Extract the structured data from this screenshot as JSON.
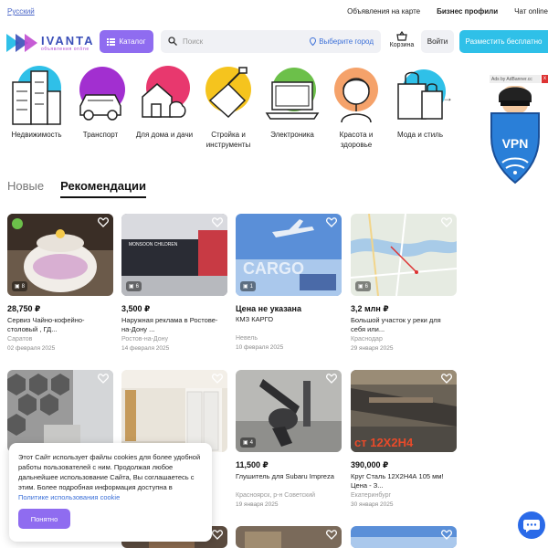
{
  "topbar": {
    "language": "Русский",
    "links": [
      "Объявления на карте",
      "Бизнес профили",
      "Чат online"
    ]
  },
  "header": {
    "logo_text": "IVANTA",
    "logo_sub": "объявления online",
    "catalog_label": "Каталог",
    "search_placeholder": "Поиск",
    "location_label": "Выберите город",
    "cart_label": "Корзина",
    "login_label": "Войти",
    "place_label": "Разместить бесплатно"
  },
  "categories": [
    {
      "label": "Недвижимость",
      "icon": "buildings-icon"
    },
    {
      "label": "Транспорт",
      "icon": "car-icon"
    },
    {
      "label": "Для дома и дачи",
      "icon": "house-icon"
    },
    {
      "label": "Стройка и инструменты",
      "icon": "trowel-icon"
    },
    {
      "label": "Электроника",
      "icon": "laptop-icon"
    },
    {
      "label": "Красота и здоровье",
      "icon": "woman-icon"
    },
    {
      "label": "Мода и стиль",
      "icon": "bags-icon"
    }
  ],
  "ad": {
    "tag": "Ads by AdBanner.cc",
    "close": "x",
    "text": "VPN"
  },
  "tabs": [
    "Новые",
    "Рекомендации"
  ],
  "listings": [
    {
      "price": "28,750 ₽",
      "title": "Сервиз Чайно-кофейно-столовый , ГД...",
      "city": "Саратов",
      "date": "02 февраля 2025",
      "photos": "8",
      "verified": true
    },
    {
      "price": "3,500 ₽",
      "title": "Наружная реклама в Ростове-на-Дону ...",
      "city": "Ростов-на-Дону",
      "date": "14 февраля 2025",
      "photos": "6",
      "verified": false
    },
    {
      "price": "Цена не указана",
      "title": "КМЗ КАРГО",
      "city": "Невель",
      "date": "10 февраля 2025",
      "photos": "1",
      "verified": false
    },
    {
      "price": "3,2 млн ₽",
      "title": "Большой участок у реки для себя или...",
      "city": "Краснодар",
      "date": "29 января 2025",
      "photos": "6",
      "verified": false
    },
    {
      "price": "",
      "title": "",
      "city": "",
      "date": "",
      "photos": "",
      "verified": false
    },
    {
      "price": "",
      "title": "",
      "city": "",
      "date": "",
      "photos": "",
      "verified": false
    },
    {
      "price": "11,500 ₽",
      "title": "Глушитель для Subaru Impreza",
      "city": "Красноярск, р-н Советский",
      "date": "19 января 2025",
      "photos": "4",
      "verified": false
    },
    {
      "price": "390,000 ₽",
      "title": "Круг Сталь 12Х2Н4А 105 мм! Цена - З...",
      "city": "Екатеринбург",
      "date": "30 января 2025",
      "photos": "",
      "verified": false
    }
  ],
  "image_text": {
    "mall": "MONSOON CHILDREN",
    "cargo": "CARGO",
    "steel": "ст 12Х2Н4"
  },
  "cookie": {
    "text": "Этот Сайт использует файлы cookies для более удобной работы пользователей с ним. Продолжая любое дальнейшее использование Сайта, Вы соглашаетесь с этим. Более подробная информация доступна в ",
    "link": "Политике использования cookie",
    "button": "Понятно"
  },
  "colors": {
    "accent": "#8f6cf0",
    "place_button": "#2fc0e8",
    "link": "#3a6fd8",
    "chat": "#2a6ae8"
  }
}
